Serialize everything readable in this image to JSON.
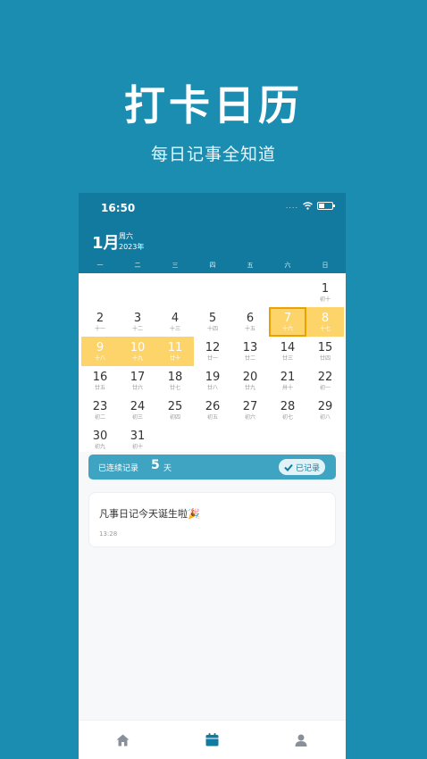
{
  "promo": {
    "title": "打卡日历",
    "subtitle": "每日记事全知道"
  },
  "status_bar": {
    "time": "16:50",
    "signal": "....",
    "icons": [
      "wifi-icon",
      "battery-icon"
    ]
  },
  "header": {
    "month": "1月",
    "weekday": "周六",
    "year": "2023年"
  },
  "weekdays": [
    "一",
    "二",
    "三",
    "四",
    "五",
    "六",
    "日"
  ],
  "calendar": {
    "days": [
      {
        "d": "",
        "l": ""
      },
      {
        "d": "",
        "l": ""
      },
      {
        "d": "",
        "l": ""
      },
      {
        "d": "",
        "l": ""
      },
      {
        "d": "",
        "l": ""
      },
      {
        "d": "",
        "l": ""
      },
      {
        "d": "1",
        "l": "初十"
      },
      {
        "d": "2",
        "l": "十一"
      },
      {
        "d": "3",
        "l": "十二"
      },
      {
        "d": "4",
        "l": "十三"
      },
      {
        "d": "5",
        "l": "十四"
      },
      {
        "d": "6",
        "l": "十五"
      },
      {
        "d": "7",
        "l": "十六",
        "hl": true,
        "today": true
      },
      {
        "d": "8",
        "l": "十七",
        "hl": true
      },
      {
        "d": "9",
        "l": "十八",
        "hl": true
      },
      {
        "d": "10",
        "l": "十九",
        "hl": true
      },
      {
        "d": "11",
        "l": "廿十",
        "hl": true
      },
      {
        "d": "12",
        "l": "廿一"
      },
      {
        "d": "13",
        "l": "廿二"
      },
      {
        "d": "14",
        "l": "廿三"
      },
      {
        "d": "15",
        "l": "廿四"
      },
      {
        "d": "16",
        "l": "廿五"
      },
      {
        "d": "17",
        "l": "廿六"
      },
      {
        "d": "18",
        "l": "廿七"
      },
      {
        "d": "19",
        "l": "廿八"
      },
      {
        "d": "20",
        "l": "廿九"
      },
      {
        "d": "21",
        "l": "卅十"
      },
      {
        "d": "22",
        "l": "初一"
      },
      {
        "d": "23",
        "l": "初二"
      },
      {
        "d": "24",
        "l": "初三"
      },
      {
        "d": "25",
        "l": "初四"
      },
      {
        "d": "26",
        "l": "初五"
      },
      {
        "d": "27",
        "l": "初六"
      },
      {
        "d": "28",
        "l": "初七"
      },
      {
        "d": "29",
        "l": "初八"
      },
      {
        "d": "30",
        "l": "初九"
      },
      {
        "d": "31",
        "l": "初十"
      }
    ],
    "highlight_color": "#fdd46a"
  },
  "streak": {
    "prefix": "已连续记录",
    "count": "5",
    "unit": "天",
    "badge": "已记录"
  },
  "entry": {
    "text": "凡事日记今天诞生啦🎉",
    "time": "13:28"
  },
  "tabs": [
    {
      "icon": "home-icon"
    },
    {
      "icon": "calendar-icon",
      "active": true
    },
    {
      "icon": "user-icon"
    }
  ],
  "colors": {
    "background": "#1a8db0",
    "header": "#137a9f",
    "accent": "#3fa4c2"
  }
}
